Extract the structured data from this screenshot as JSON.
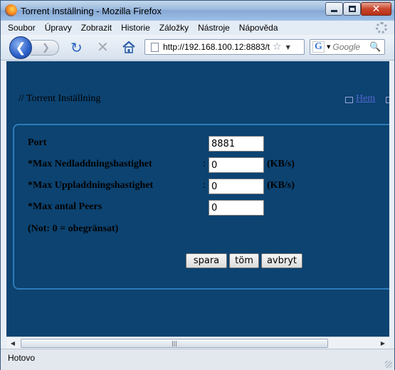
{
  "window": {
    "title": "Torrent Inställning - Mozilla Firefox",
    "close_glyph": "✕"
  },
  "menu": [
    "Soubor",
    "Úpravy",
    "Zobrazit",
    "Historie",
    "Záložky",
    "Nástroje",
    "Nápověda"
  ],
  "nav": {
    "back_glyph": "❮",
    "forward_glyph": "❯",
    "reload_glyph": "↻",
    "stop_glyph": "✕",
    "url": "http://192.168.100.12:8883/t",
    "star_glyph": "☆",
    "dropdown_glyph": "▼",
    "search_engine_glyph": "G",
    "search_placeholder": "Google",
    "search_glyph": "🔍"
  },
  "page": {
    "title": "// Torrent Inställning",
    "home_link": "Hem",
    "background_color": "#0c4371",
    "panel_border_color": "#2d7ab8",
    "link_color": "#5566cc",
    "form": {
      "fields": [
        {
          "label": "Port",
          "value": "8881",
          "unit": ""
        },
        {
          "label": "*Max Nedladdningshastighet",
          "value": "0",
          "unit": "(KB/s)"
        },
        {
          "label": "*Max Uppladdningshastighet",
          "value": "0",
          "unit": "(KB/s)"
        },
        {
          "label": "*Max antal Peers",
          "value": "0",
          "unit": ""
        }
      ],
      "colon": ":",
      "note": "(Not: 0 = obegränsat)",
      "buttons": {
        "save": "spara",
        "clear": "töm",
        "cancel": "avbryt"
      }
    }
  },
  "scrollbar": {
    "left_glyph": "◀",
    "right_glyph": "▶",
    "grip_glyph": "|||"
  },
  "status": {
    "text": "Hotovo"
  }
}
